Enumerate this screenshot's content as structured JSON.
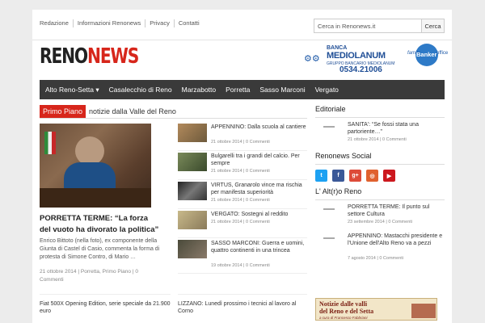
{
  "topbar": {
    "links": [
      "Redazione",
      "Informazioni Renonews",
      "Privacy",
      "Contatti"
    ],
    "search_placeholder": "Cerca in Renonews.it",
    "search_button": "Cerca"
  },
  "logo": {
    "part1": "RENO",
    "part2": "NEWS"
  },
  "ad": {
    "bank_top": "BANCA",
    "bank_name": "MEDIOLANUM",
    "bank_sub": "GRUPPO BANCARIO MEDIOLANUM",
    "phone": "0534.21006",
    "family": "family",
    "banker": "Banker",
    "office": "office"
  },
  "nav": [
    "Alto Reno-Setta ▾",
    "Casalecchio di Reno",
    "Marzabotto",
    "Porretta",
    "Sasso Marconi",
    "Vergato"
  ],
  "section": {
    "tag": "Primo Piano",
    "subtitle": "notizie dalla Valle del Reno"
  },
  "feature": {
    "title": "PORRETTA TERME: “La forza del vuoto ha divorato la politica”",
    "excerpt": "Enrico Bittoto (nella foto), ex componente della Giunta di Castel di Casio, commenta la forma di protesta di Simone Contro, di Mario …",
    "date": "21 ottobre 2014",
    "cat1": "Porretta",
    "cat2": "Primo Piano",
    "comments": "0 Commenti"
  },
  "list": [
    {
      "title": "APPENNINO: Dalla scuola al cantiere",
      "date": "21 ottobre 2014 | 0 Commenti"
    },
    {
      "title": "Bulgarelli tra i grandi del calcio. Per sempre",
      "date": "21 ottobre 2014 | 0 Commenti"
    },
    {
      "title": "VIRTUS, Granarolo vince ma rischia per manifesta superiorità",
      "date": "21 ottobre 2014 | 0 Commenti"
    },
    {
      "title": "VERGATO: Sostegni al reddito",
      "date": "21 ottobre 2014 | 0 Commenti"
    },
    {
      "title": "SASSO MARCONI: Guerra e uomini, quattro continenti in una trincea",
      "date": "19 ottobre 2014 | 0 Commenti"
    }
  ],
  "bottom": {
    "left": "Fiat 500X Opening Edition, serie speciale da 21.900 euro",
    "right": "LIZZANO: Lunedì prossimo i tecnici al lavoro al Corno"
  },
  "sidebar": {
    "editoriale_title": "Editoriale",
    "editoriale": {
      "title": "SANITA': “Se fossi stata una partoriente…”",
      "date": "21 ottobre 2014 | 0 Commenti"
    },
    "social_title": "Renonews Social",
    "social": [
      "t",
      "f",
      "g+",
      "◎",
      "▶"
    ],
    "altro_title": "L' Alt(r)o Reno",
    "altro": [
      {
        "title": "PORRETTA TERME: Il punto sul settore Cultura",
        "date": "23 settembre 2014 | 0 Commenti"
      },
      {
        "title": "APPENNINO: Mastacchi presidente e l'Unione dell'Alto Reno va a pezzi",
        "date": "7 agosto 2014 | 0 Commenti"
      }
    ],
    "banner_l1": "Notizie dalle valli",
    "banner_l2": "del Reno e del Setta",
    "banner_l3": "a cura di Francesco Fabbriani"
  },
  "colors": {
    "brand_red": "#d7261b",
    "nav_bg": "#3a3a3a",
    "twitter": "#1da1f2",
    "facebook": "#3b5998",
    "gplus": "#dd4b39",
    "instagram": "#e0612e",
    "youtube": "#cc181e"
  }
}
